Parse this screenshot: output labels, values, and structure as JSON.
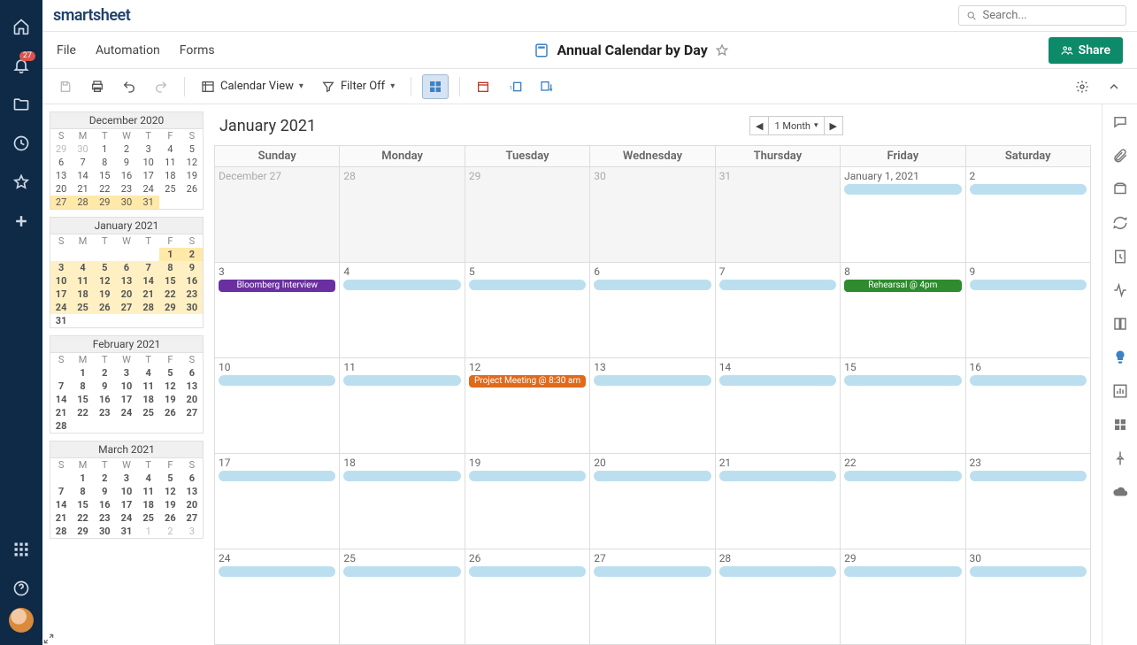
{
  "app": {
    "logo_text": "smartsheet",
    "page_title": "Annual Calendar by Day",
    "search_placeholder": "Search...",
    "share_label": "Share",
    "notification_count": "27"
  },
  "menu": {
    "file": "File",
    "automation": "Automation",
    "forms": "Forms"
  },
  "toolbar": {
    "view_label": "Calendar View",
    "filter_label": "Filter Off"
  },
  "calendar": {
    "month_label": "January 2021",
    "range_label": "1 Month",
    "weekdays": [
      "Sunday",
      "Monday",
      "Tuesday",
      "Wednesday",
      "Thursday",
      "Friday",
      "Saturday"
    ],
    "rows": [
      [
        {
          "date": "December 27",
          "other": true
        },
        {
          "date": "28",
          "other": true
        },
        {
          "date": "29",
          "other": true
        },
        {
          "date": "30",
          "other": true
        },
        {
          "date": "31",
          "other": true
        },
        {
          "date": "January 1, 2021",
          "bar": "blue"
        },
        {
          "date": "2",
          "bar": "blue"
        }
      ],
      [
        {
          "date": "3",
          "event": {
            "text": "Bloomberg Interview",
            "color": "purple"
          }
        },
        {
          "date": "4",
          "bar": "blue"
        },
        {
          "date": "5",
          "bar": "blue"
        },
        {
          "date": "6",
          "bar": "blue"
        },
        {
          "date": "7",
          "bar": "blue"
        },
        {
          "date": "8",
          "event": {
            "text": "Rehearsal @ 4pm",
            "color": "green"
          }
        },
        {
          "date": "9",
          "bar": "blue"
        }
      ],
      [
        {
          "date": "10",
          "bar": "blue"
        },
        {
          "date": "11",
          "bar": "blue"
        },
        {
          "date": "12",
          "event": {
            "text": "Project Meeting @ 8:30 am",
            "color": "orange"
          }
        },
        {
          "date": "13",
          "bar": "blue"
        },
        {
          "date": "14",
          "bar": "blue"
        },
        {
          "date": "15",
          "bar": "blue"
        },
        {
          "date": "16",
          "bar": "blue"
        }
      ],
      [
        {
          "date": "17",
          "bar": "blue"
        },
        {
          "date": "18",
          "bar": "blue"
        },
        {
          "date": "19",
          "bar": "blue"
        },
        {
          "date": "20",
          "bar": "blue"
        },
        {
          "date": "21",
          "bar": "blue"
        },
        {
          "date": "22",
          "bar": "blue"
        },
        {
          "date": "23",
          "bar": "blue"
        }
      ],
      [
        {
          "date": "24",
          "bar": "blue"
        },
        {
          "date": "25",
          "bar": "blue"
        },
        {
          "date": "26",
          "bar": "blue"
        },
        {
          "date": "27",
          "bar": "blue"
        },
        {
          "date": "28",
          "bar": "blue"
        },
        {
          "date": "29",
          "bar": "blue"
        },
        {
          "date": "30",
          "bar": "blue"
        }
      ]
    ]
  },
  "mini_calendars": [
    {
      "title": "December 2020",
      "dow": [
        "S",
        "M",
        "T",
        "W",
        "T",
        "F",
        "S"
      ],
      "weeks": [
        [
          {
            "d": "29",
            "g": 1
          },
          {
            "d": "30",
            "g": 1
          },
          {
            "d": "1"
          },
          {
            "d": "2"
          },
          {
            "d": "3"
          },
          {
            "d": "4"
          },
          {
            "d": "5"
          }
        ],
        [
          {
            "d": "6"
          },
          {
            "d": "7"
          },
          {
            "d": "8"
          },
          {
            "d": "9"
          },
          {
            "d": "10"
          },
          {
            "d": "11"
          },
          {
            "d": "12"
          }
        ],
        [
          {
            "d": "13"
          },
          {
            "d": "14"
          },
          {
            "d": "15"
          },
          {
            "d": "16"
          },
          {
            "d": "17"
          },
          {
            "d": "18"
          },
          {
            "d": "19"
          }
        ],
        [
          {
            "d": "20"
          },
          {
            "d": "21"
          },
          {
            "d": "22"
          },
          {
            "d": "23"
          },
          {
            "d": "24"
          },
          {
            "d": "25"
          },
          {
            "d": "26"
          }
        ],
        [
          {
            "d": "27",
            "hl": "Y"
          },
          {
            "d": "28",
            "hl": "Y"
          },
          {
            "d": "29",
            "hl": "Y"
          },
          {
            "d": "30",
            "hl": "Y"
          },
          {
            "d": "31",
            "hl": "Y"
          },
          {
            "d": ""
          },
          {
            "d": ""
          }
        ]
      ]
    },
    {
      "title": "January 2021",
      "dow": [
        "S",
        "M",
        "T",
        "W",
        "T",
        "F",
        "S"
      ],
      "weeks": [
        [
          {
            "d": ""
          },
          {
            "d": ""
          },
          {
            "d": ""
          },
          {
            "d": ""
          },
          {
            "d": ""
          },
          {
            "d": "1",
            "hl": "Y",
            "b": 1
          },
          {
            "d": "2",
            "hl": "Y",
            "b": 1
          }
        ],
        [
          {
            "d": "3",
            "hl": "O"
          },
          {
            "d": "4",
            "hl": "O"
          },
          {
            "d": "5",
            "hl": "O"
          },
          {
            "d": "6",
            "hl": "O"
          },
          {
            "d": "7",
            "hl": "O"
          },
          {
            "d": "8",
            "hl": "O"
          },
          {
            "d": "9",
            "hl": "O"
          }
        ],
        [
          {
            "d": "10",
            "hl": "O"
          },
          {
            "d": "11",
            "hl": "O"
          },
          {
            "d": "12",
            "hl": "O"
          },
          {
            "d": "13",
            "hl": "O"
          },
          {
            "d": "14",
            "hl": "O"
          },
          {
            "d": "15",
            "hl": "O"
          },
          {
            "d": "16",
            "hl": "O"
          }
        ],
        [
          {
            "d": "17",
            "hl": "O"
          },
          {
            "d": "18",
            "hl": "O"
          },
          {
            "d": "19",
            "hl": "O"
          },
          {
            "d": "20",
            "hl": "O"
          },
          {
            "d": "21",
            "hl": "O"
          },
          {
            "d": "22",
            "hl": "O"
          },
          {
            "d": "23",
            "hl": "O"
          }
        ],
        [
          {
            "d": "24",
            "hl": "O"
          },
          {
            "d": "25",
            "hl": "O"
          },
          {
            "d": "26",
            "hl": "O"
          },
          {
            "d": "27",
            "hl": "O"
          },
          {
            "d": "28",
            "hl": "O"
          },
          {
            "d": "29",
            "hl": "O"
          },
          {
            "d": "30",
            "hl": "O"
          }
        ],
        [
          {
            "d": "31",
            "b": 1
          },
          {
            "d": ""
          },
          {
            "d": ""
          },
          {
            "d": ""
          },
          {
            "d": ""
          },
          {
            "d": ""
          },
          {
            "d": ""
          }
        ]
      ]
    },
    {
      "title": "February 2021",
      "dow": [
        "S",
        "M",
        "T",
        "W",
        "T",
        "F",
        "S"
      ],
      "weeks": [
        [
          {
            "d": ""
          },
          {
            "d": "1",
            "b": 1
          },
          {
            "d": "2",
            "b": 1
          },
          {
            "d": "3",
            "b": 1
          },
          {
            "d": "4",
            "b": 1
          },
          {
            "d": "5",
            "b": 1
          },
          {
            "d": "6",
            "b": 1
          }
        ],
        [
          {
            "d": "7",
            "b": 1
          },
          {
            "d": "8",
            "b": 1
          },
          {
            "d": "9",
            "b": 1
          },
          {
            "d": "10",
            "b": 1
          },
          {
            "d": "11",
            "b": 1
          },
          {
            "d": "12",
            "b": 1
          },
          {
            "d": "13",
            "b": 1
          }
        ],
        [
          {
            "d": "14",
            "b": 1
          },
          {
            "d": "15",
            "b": 1
          },
          {
            "d": "16",
            "b": 1
          },
          {
            "d": "17",
            "b": 1
          },
          {
            "d": "18",
            "b": 1
          },
          {
            "d": "19",
            "b": 1
          },
          {
            "d": "20",
            "b": 1
          }
        ],
        [
          {
            "d": "21",
            "b": 1
          },
          {
            "d": "22",
            "b": 1
          },
          {
            "d": "23",
            "b": 1
          },
          {
            "d": "24",
            "b": 1
          },
          {
            "d": "25",
            "b": 1
          },
          {
            "d": "26",
            "b": 1
          },
          {
            "d": "27",
            "b": 1
          }
        ],
        [
          {
            "d": "28",
            "b": 1
          },
          {
            "d": ""
          },
          {
            "d": ""
          },
          {
            "d": ""
          },
          {
            "d": ""
          },
          {
            "d": ""
          },
          {
            "d": ""
          }
        ]
      ]
    },
    {
      "title": "March 2021",
      "dow": [
        "S",
        "M",
        "T",
        "W",
        "T",
        "F",
        "S"
      ],
      "weeks": [
        [
          {
            "d": ""
          },
          {
            "d": "1",
            "b": 1
          },
          {
            "d": "2",
            "b": 1
          },
          {
            "d": "3",
            "b": 1
          },
          {
            "d": "4",
            "b": 1
          },
          {
            "d": "5",
            "b": 1
          },
          {
            "d": "6",
            "b": 1
          }
        ],
        [
          {
            "d": "7",
            "b": 1
          },
          {
            "d": "8",
            "b": 1
          },
          {
            "d": "9",
            "b": 1
          },
          {
            "d": "10",
            "b": 1
          },
          {
            "d": "11",
            "b": 1
          },
          {
            "d": "12",
            "b": 1
          },
          {
            "d": "13",
            "b": 1
          }
        ],
        [
          {
            "d": "14",
            "b": 1
          },
          {
            "d": "15",
            "b": 1
          },
          {
            "d": "16",
            "b": 1
          },
          {
            "d": "17",
            "b": 1
          },
          {
            "d": "18",
            "b": 1
          },
          {
            "d": "19",
            "b": 1
          },
          {
            "d": "20",
            "b": 1
          }
        ],
        [
          {
            "d": "21",
            "b": 1
          },
          {
            "d": "22",
            "b": 1
          },
          {
            "d": "23",
            "b": 1
          },
          {
            "d": "24",
            "b": 1
          },
          {
            "d": "25",
            "b": 1
          },
          {
            "d": "26",
            "b": 1
          },
          {
            "d": "27",
            "b": 1
          }
        ],
        [
          {
            "d": "28",
            "b": 1
          },
          {
            "d": "29",
            "b": 1
          },
          {
            "d": "30",
            "b": 1
          },
          {
            "d": "31",
            "b": 1
          },
          {
            "d": "1",
            "g": 1
          },
          {
            "d": "2",
            "g": 1
          },
          {
            "d": "3",
            "g": 1
          }
        ]
      ]
    }
  ]
}
